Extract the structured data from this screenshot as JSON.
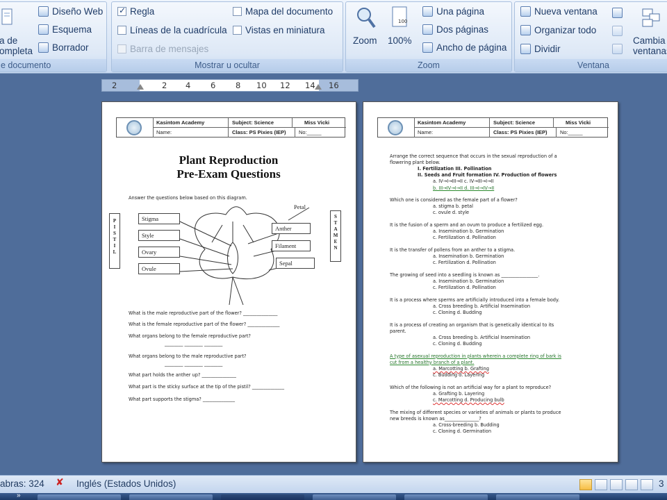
{
  "ribbon": {
    "group1": {
      "label": "e documento",
      "big_label_line1": "a de",
      "big_label_line2": "ompleta",
      "items": [
        "Diseño Web",
        "Esquema",
        "Borrador"
      ]
    },
    "group2": {
      "label": "Mostrar u ocultar",
      "regla": "Regla",
      "lineas": "Líneas de la cuadrícula",
      "barra": "Barra de mensajes",
      "mapa": "Mapa del documento",
      "vistas": "Vistas en miniatura",
      "regla_checked": true
    },
    "group3": {
      "label": "Zoom",
      "zoom": "Zoom",
      "percent": "100%",
      "una": "Una página",
      "dos": "Dos páginas",
      "ancho": "Ancho de página"
    },
    "group4": {
      "label": "Ventana",
      "nueva": "Nueva ventana",
      "organizar": "Organizar todo",
      "dividir": "Dividir",
      "cambiar_line1": "Cambia",
      "cambiar_line2": "ventanas"
    }
  },
  "ruler": {
    "ticks": [
      "2",
      "2",
      "4",
      "6",
      "8",
      "10",
      "12",
      "14",
      "16"
    ]
  },
  "page1": {
    "school": "Kasintom Academy",
    "subject": "Subject: Science",
    "teacher": "Miss Vicki",
    "name": "Name:",
    "class": "Class: PS Pixies (IEP)",
    "no": "No:_____",
    "title_line1": "Plant Reproduction",
    "title_line2": "Pre-Exam Questions",
    "instruction": "Answer the questions  below  based on this diagram.",
    "diagram": {
      "pistil": "P\nI\nS\nT\nI\nL",
      "stamen": "S\nT\nA\nM\nE\nN",
      "labels_left": [
        "Stigma",
        "Style",
        "Ovary",
        "Ovule"
      ],
      "labels_right": [
        "Anther",
        "Filament",
        "Sepal"
      ],
      "petal": "Petal"
    },
    "questions": [
      "What is the male reproductive  part of the flower?  _______________",
      "What is the female reproductive  part of the flower?  ______________",
      "What organs  belong  to the female reproductive  part?",
      "________        ________        ________",
      "What organs  belong  to the male reproductive  part?",
      "________        ________        ________",
      "What part holds the anther  up? _______________",
      "What part is the sticky surface at the tip of the pistil? ______________",
      "What part supports  the stigma? ______________"
    ]
  },
  "page2": {
    "school": "Kasintom Academy",
    "subject": "Subject: Science",
    "teacher": "Miss Vicki",
    "name": "Name:",
    "class": "Class: PS Pixies (IEP)",
    "no": "No:_____",
    "lines": [
      {
        "t": "Arrange the correct sequence that occurs in the sexual reproduction of a",
        "x": 0,
        "s": ""
      },
      {
        "t": "flowering plant below.",
        "x": 0,
        "s": ""
      },
      {
        "t": "I. Fertilization                              III. Pollination",
        "x": 40,
        "s": "b"
      },
      {
        "t": "II. Seeds and Fruit formation        IV. Production of flowers",
        "x": 40,
        "s": "b"
      },
      {
        "t": "a. IV→I→III→II              c. IV→III→I→II",
        "x": 62,
        "s": ""
      },
      {
        "t": "b. III→IV→I→II              d. III→I→IV→II",
        "x": 62,
        "s": "g"
      },
      {
        "t": "Which one is considered as the female part of a flower?",
        "x": 0,
        "s": ""
      },
      {
        "t": "a. stigma                      b. petal",
        "x": 62,
        "s": ""
      },
      {
        "t": "c. ovule                        d. style",
        "x": 62,
        "s": ""
      },
      {
        "t": "It is the fusion of a sperm and an ovum to produce a fertilized egg.",
        "x": 0,
        "s": ""
      },
      {
        "t": "a. Insemination              b. Germination",
        "x": 62,
        "s": ""
      },
      {
        "t": "c. Fertilization               d. Pollination",
        "x": 62,
        "s": ""
      },
      {
        "t": "It is the transfer of pollens from an anther to a stigma.",
        "x": 0,
        "s": ""
      },
      {
        "t": "a. Insemination              b. Germination",
        "x": 62,
        "s": ""
      },
      {
        "t": "c. Fertilization               d. Pollination",
        "x": 62,
        "s": ""
      },
      {
        "t": "The growing of seed into a seedling is known as ________________.",
        "x": 0,
        "s": ""
      },
      {
        "t": "a. Insemination              b. Germination",
        "x": 62,
        "s": ""
      },
      {
        "t": "c. Fertilization               d. Pollination",
        "x": 62,
        "s": ""
      },
      {
        "t": "It is a process where sperms are artificially introduced into a female body.",
        "x": 0,
        "s": ""
      },
      {
        "t": "a. Cross breeding           b. Artificial Insemination",
        "x": 62,
        "s": ""
      },
      {
        "t": "c. Cloning                      d. Budding",
        "x": 62,
        "s": ""
      },
      {
        "t": "It is a process of creating an organism that is genetically identical to its",
        "x": 0,
        "s": ""
      },
      {
        "t": "parent.",
        "x": 0,
        "s": ""
      },
      {
        "t": "a. Cross breeding           b. Artificial Insemination",
        "x": 62,
        "s": ""
      },
      {
        "t": "c. Cloning                      d. Budding",
        "x": 62,
        "s": ""
      },
      {
        "t": "A type of asexual  reproduction in plants wherein a complete ring of bark is",
        "x": 0,
        "s": "g"
      },
      {
        "t": "cut from a healthy branch of a plant.",
        "x": 0,
        "s": "g"
      },
      {
        "t": "a. Marcotting                  b. Grafting",
        "x": 62,
        "s": "r"
      },
      {
        "t": "c. Budding                       d. Layering",
        "x": 62,
        "s": ""
      },
      {
        "t": "Which of the following is not an artificial way for a plant to reproduce?",
        "x": 0,
        "s": ""
      },
      {
        "t": "a. Grafting                      b. Layering",
        "x": 62,
        "s": ""
      },
      {
        "t": "c. Marcotting                  d. Producing bulb",
        "x": 62,
        "s": "r"
      },
      {
        "t": "The mixing of different species or varieties of animals or plants to produce",
        "x": 0,
        "s": ""
      },
      {
        "t": "new breeds is known as_______________?",
        "x": 0,
        "s": ""
      },
      {
        "t": "a. Cross-breeding                       b. Budding",
        "x": 62,
        "s": ""
      },
      {
        "t": "c. Cloning                                 d. Germination",
        "x": 62,
        "s": ""
      }
    ]
  },
  "status": {
    "words": "abras: 324",
    "language": "Inglés (Estados Unidos)",
    "zoom": "3"
  }
}
